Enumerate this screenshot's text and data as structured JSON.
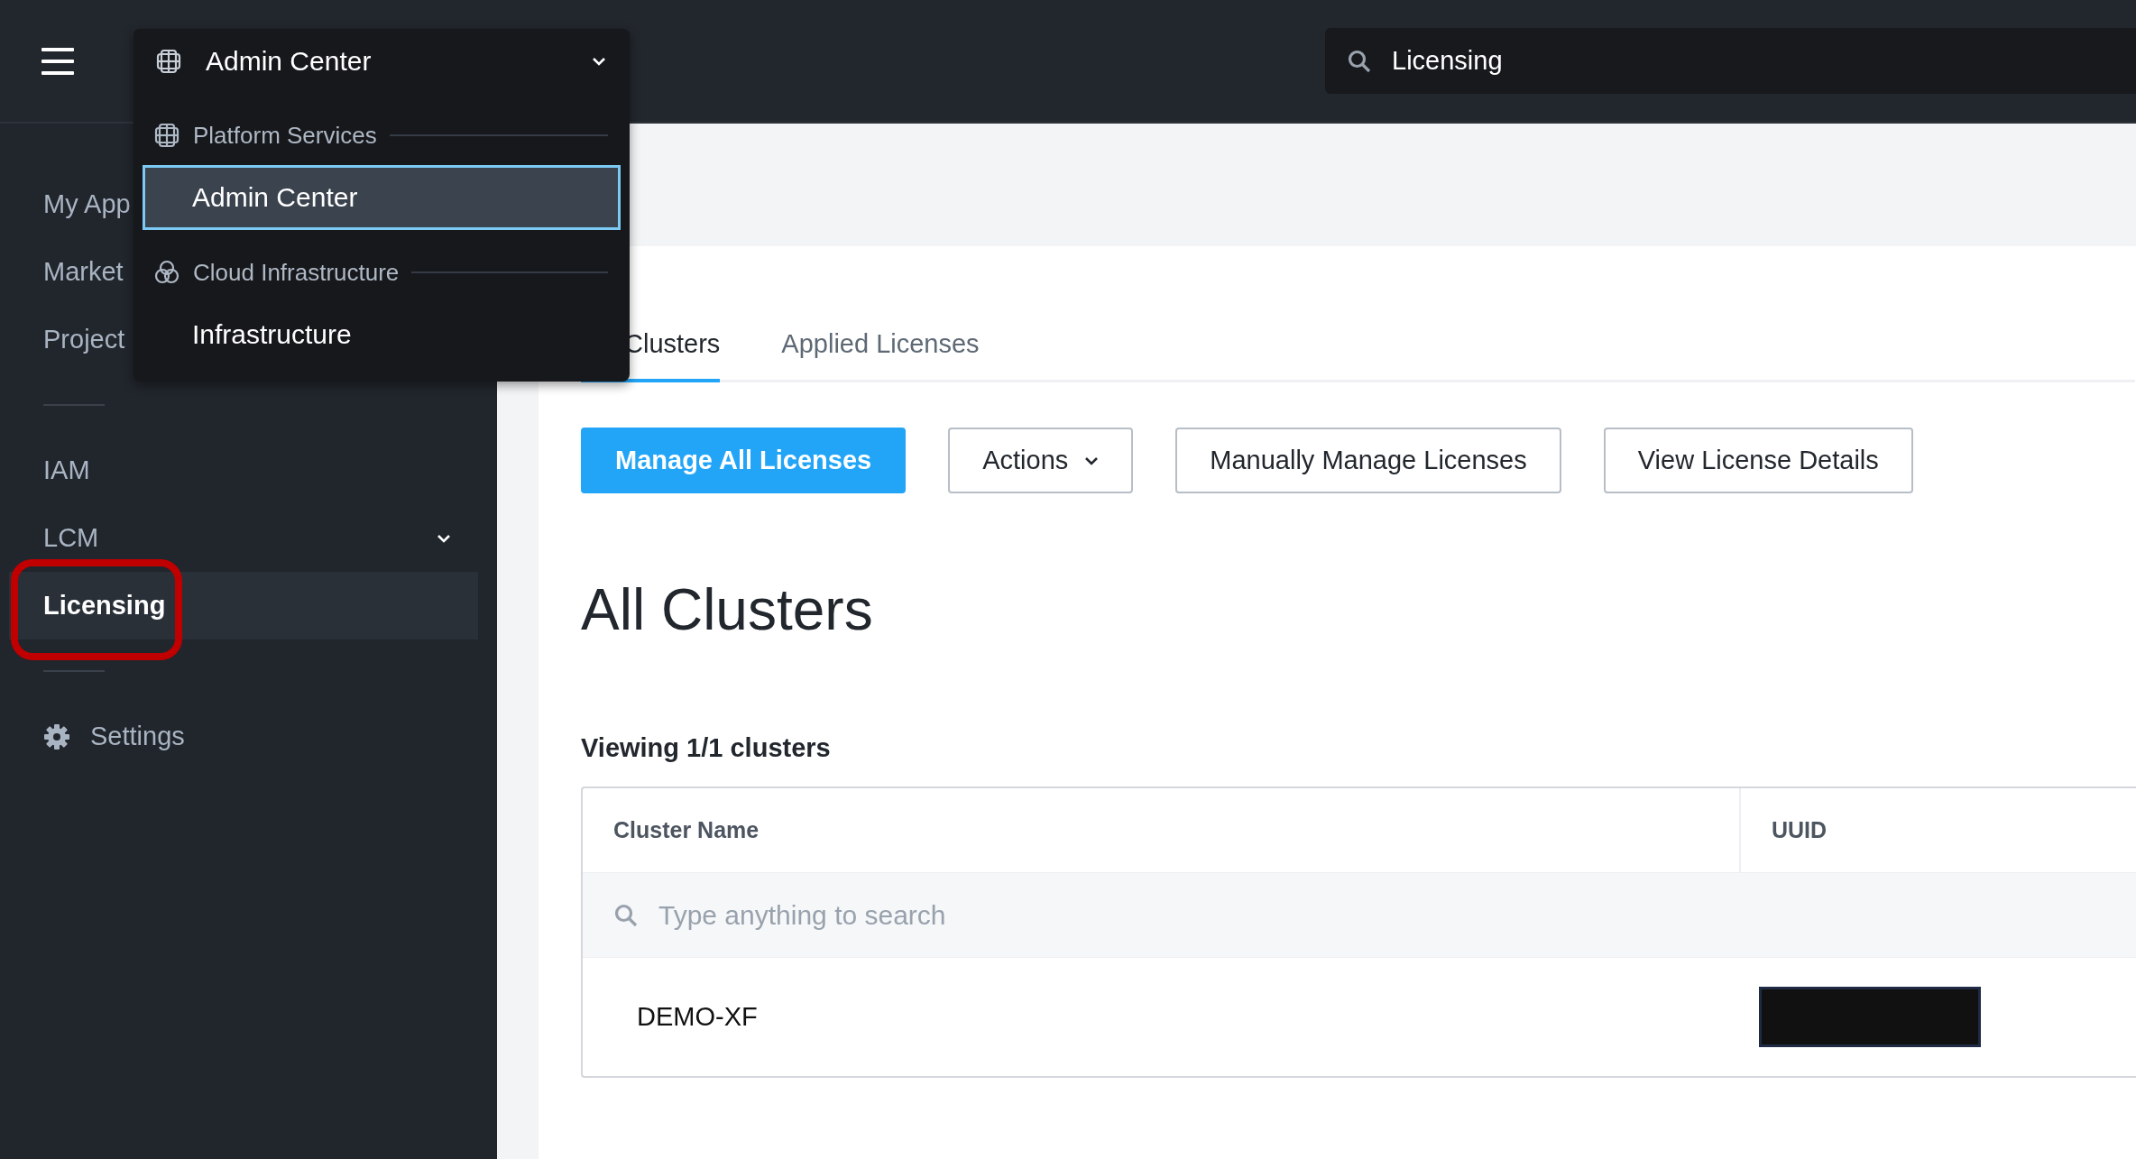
{
  "top_bar": {
    "app_switcher": {
      "label": "Admin Center",
      "expanded": true
    },
    "search": {
      "value": "Licensing"
    }
  },
  "app_menu": {
    "groups": [
      {
        "label": "Platform Services",
        "kind": "platform",
        "items": [
          {
            "label": "Admin Center",
            "selected": true
          }
        ]
      },
      {
        "label": "Cloud Infrastructure",
        "kind": "cloud",
        "items": [
          {
            "label": "Infrastructure",
            "selected": false
          }
        ]
      }
    ]
  },
  "sidebar": {
    "items": [
      {
        "kind": "link",
        "label": "My App",
        "selected": false,
        "highlighted": false
      },
      {
        "kind": "link",
        "label": "Market",
        "selected": false,
        "highlighted": false
      },
      {
        "kind": "link",
        "label": "Project",
        "selected": false,
        "highlighted": false
      },
      {
        "kind": "divider"
      },
      {
        "kind": "link",
        "label": "IAM",
        "selected": false,
        "highlighted": false
      },
      {
        "kind": "group",
        "label": "LCM",
        "expanded": false
      },
      {
        "kind": "link",
        "label": "Licensing",
        "selected": true,
        "highlighted": true
      },
      {
        "kind": "divider"
      },
      {
        "kind": "settings",
        "label": "Settings",
        "selected": false,
        "highlighted": false
      }
    ]
  },
  "tabs": [
    {
      "label": "Clusters",
      "selected": true
    },
    {
      "label": "Applied Licenses",
      "selected": false
    }
  ],
  "buttons": [
    {
      "label": "Manage All Licenses",
      "kind": "primary"
    },
    {
      "label": "Actions",
      "kind": "menu"
    },
    {
      "label": "Manually Manage Licenses",
      "kind": "default"
    },
    {
      "label": "View License Details",
      "kind": "default"
    }
  ],
  "heading": "All Clusters",
  "table": {
    "caption": "Viewing 1/1 clusters",
    "columns": [
      "Cluster Name",
      "UUID"
    ],
    "search": {
      "placeholder": "Type anything to search"
    },
    "rows": [
      {
        "cells": [
          "DEMO-XF"
        ],
        "redacted": true
      }
    ]
  }
}
